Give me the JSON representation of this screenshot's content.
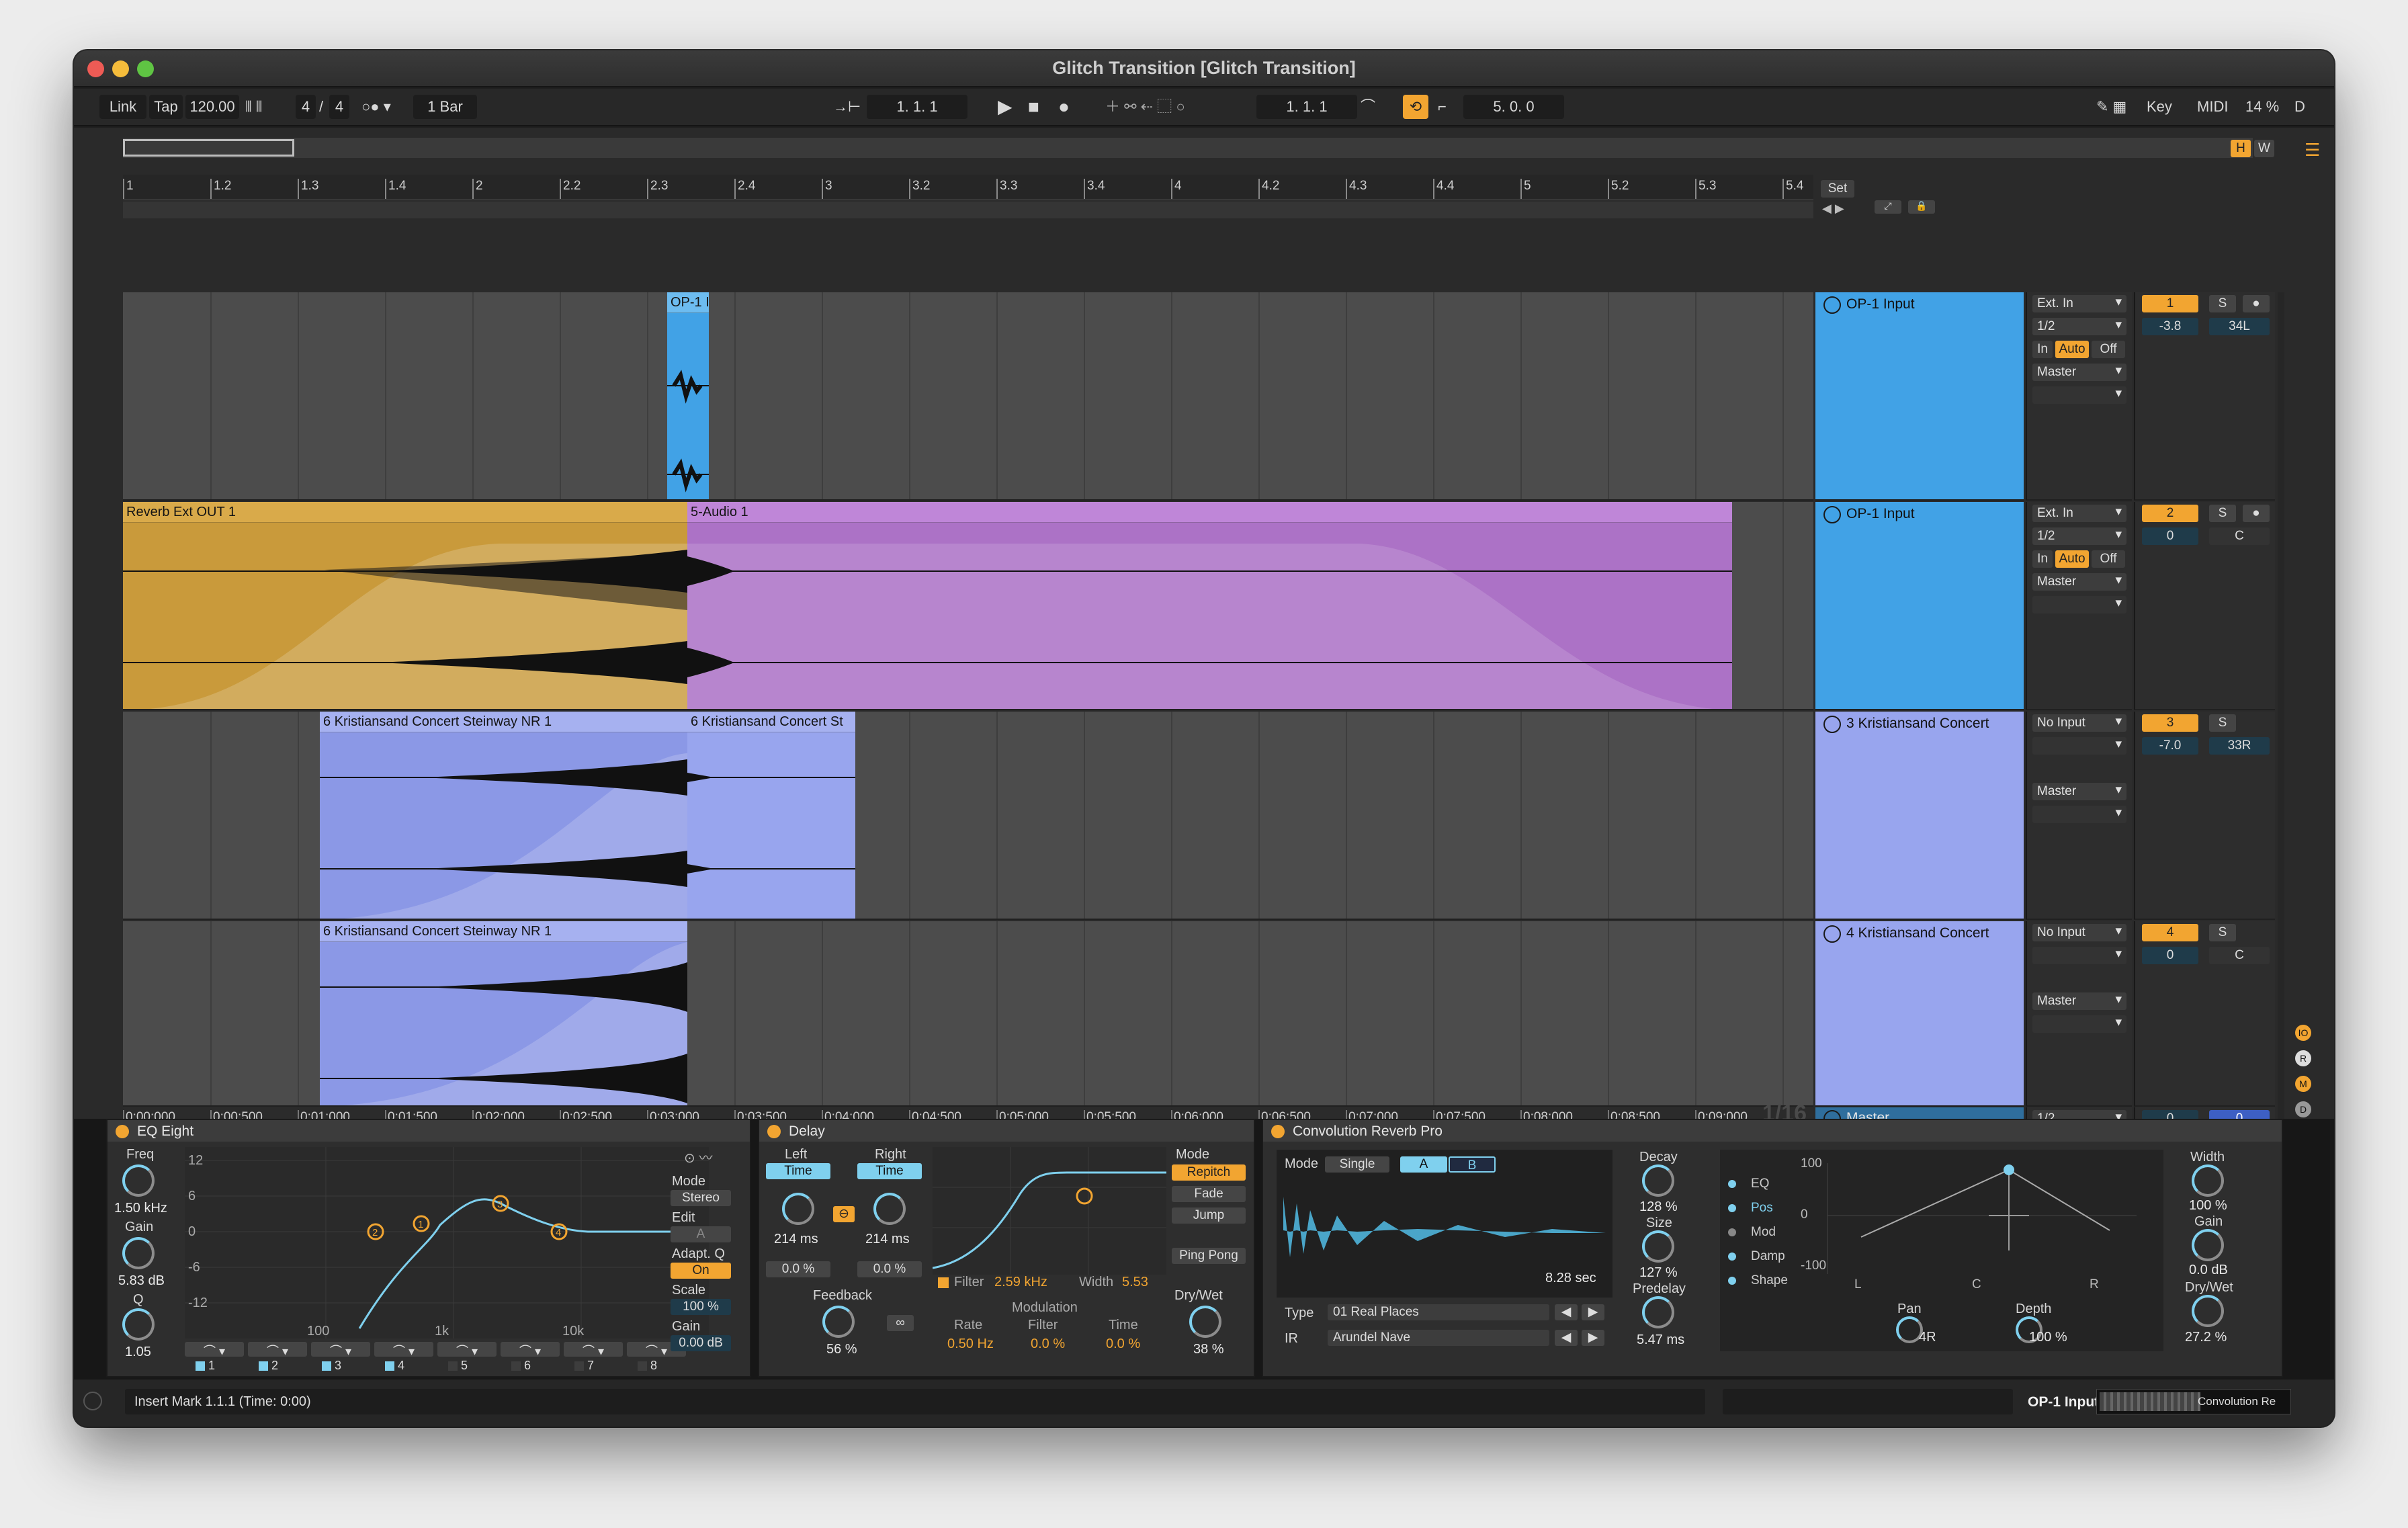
{
  "window": {
    "title": "Glitch Transition  [Glitch Transition]"
  },
  "transport": {
    "link": "Link",
    "tap": "Tap",
    "tempo": "120.00",
    "signature_num": "4",
    "signature_den": "4",
    "quantize": "1 Bar",
    "position": "1.   1.   1",
    "loop_start": "1.   1.   1",
    "loop_length": "5.   0.   0",
    "key": "Key",
    "midi": "MIDI",
    "cpu": "14 %",
    "d": "D"
  },
  "overview": {
    "h": "H",
    "w": "W"
  },
  "ruler": {
    "bars": [
      "1",
      "1.2",
      "1.3",
      "1.4",
      "2",
      "2.2",
      "2.3",
      "2.4",
      "3",
      "3.2",
      "3.3",
      "3.4",
      "4",
      "4.2",
      "4.3",
      "4.4",
      "5",
      "5.2",
      "5.3",
      "5.4"
    ],
    "times": [
      "0:00:000",
      "0:00:500",
      "0:01:000",
      "0:01:500",
      "0:02:000",
      "0:02:500",
      "0:03:000",
      "0:03:500",
      "0:04:000",
      "0:04:500",
      "0:05:000",
      "0:05:500",
      "0:06:000",
      "0:06:500",
      "0:07:000",
      "0:07:500",
      "0:08:000",
      "0:08:500",
      "0:09:000"
    ],
    "set": "Set",
    "grid": "1/16"
  },
  "tracks": [
    {
      "name": "OP-1 Input",
      "color": "#41a2e6",
      "input": "Ext. In",
      "channel": "1/2",
      "monitor": [
        "In",
        "Auto",
        "Off"
      ],
      "output": "Master",
      "number": "1",
      "s": "S",
      "volume": "-3.8",
      "pan": "34L",
      "clips": [
        {
          "name": "OP-1 I",
          "color": "#41a2e6"
        }
      ]
    },
    {
      "name": "OP-1 Input",
      "color": "#41a2e6",
      "input": "Ext. In",
      "channel": "1/2",
      "monitor": [
        "In",
        "Auto",
        "Off"
      ],
      "output": "Master",
      "number": "2",
      "s": "S",
      "volume": "0",
      "pan": "C",
      "clips": [
        {
          "name": "Reverb Ext OUT 1",
          "color": "#d5a440"
        },
        {
          "name": "5-Audio 1",
          "color": "#ba7fd2"
        }
      ]
    },
    {
      "name": "3 Kristiansand Concert",
      "color": "#98a5ee",
      "input": "No Input",
      "output": "Master",
      "number": "3",
      "s": "S",
      "volume": "-7.0",
      "pan": "33R",
      "clips": [
        {
          "name": "6 Kristiansand Concert Steinway NR 1",
          "color": "#98a5ee"
        },
        {
          "name": "6 Kristiansand Concert St",
          "color": "#98a5ee"
        }
      ]
    },
    {
      "name": "4 Kristiansand Concert",
      "color": "#98a5ee",
      "input": "No Input",
      "output": "Master",
      "number": "4",
      "s": "S",
      "volume": "0",
      "pan": "C",
      "clips": [
        {
          "name": "6 Kristiansand Concert Steinway NR 1",
          "color": "#98a5ee"
        }
      ]
    }
  ],
  "master": {
    "name": "Master",
    "channel": "1/2",
    "volume": "0",
    "pan": "0"
  },
  "side_letters": [
    "IO",
    "R",
    "M",
    "D"
  ],
  "eq": {
    "title": "EQ Eight",
    "freq_label": "Freq",
    "freq": "1.50 kHz",
    "gain_label": "Gain",
    "gain": "5.83 dB",
    "q_label": "Q",
    "q": "1.05",
    "db_ticks": [
      "12",
      "6",
      "0",
      "-6",
      "-12"
    ],
    "freq_ticks": [
      "100",
      "1k",
      "10k"
    ],
    "mode_label": "Mode",
    "mode": "Stereo",
    "edit_label": "Edit",
    "edit": "A",
    "adapt_label": "Adapt. Q",
    "adapt": "On",
    "scale_label": "Scale",
    "scale": "100 %",
    "out_gain_label": "Gain",
    "out_gain": "0.00 dB",
    "bands": [
      "1",
      "2",
      "3",
      "4",
      "5",
      "6",
      "7",
      "8"
    ],
    "nodes": [
      "1",
      "2",
      "3",
      "4"
    ]
  },
  "delay": {
    "title": "Delay",
    "left": "Left",
    "right": "Right",
    "time": "Time",
    "left_ms": "214 ms",
    "right_ms": "214 ms",
    "left_off": "0.0 %",
    "right_off": "0.0 %",
    "feedback_label": "Feedback",
    "feedback": "56 %",
    "filter_label": "Filter",
    "filter_freq": "2.59 kHz",
    "width_label": "Width",
    "width": "5.53",
    "modulation": "Modulation",
    "rate_label": "Rate",
    "rate": "0.50 Hz",
    "mfilter_label": "Filter",
    "mfilter": "0.0 %",
    "mtime_label": "Time",
    "mtime": "0.0 %",
    "mode_label": "Mode",
    "modes": [
      "Repitch",
      "Fade",
      "Jump"
    ],
    "ping_pong": "Ping Pong",
    "drywet_label": "Dry/Wet",
    "drywet": "38 %"
  },
  "reverb": {
    "title": "Convolution Reverb Pro",
    "mode_label": "Mode",
    "mode": "Single",
    "a": "A",
    "b": "B",
    "decay_time": "8.28 sec",
    "type_label": "Type",
    "type": "01 Real Places",
    "ir_label": "IR",
    "ir": "Arundel Nave",
    "decay_label": "Decay",
    "decay": "128 %",
    "size_label": "Size",
    "size": "127 %",
    "predelay_label": "Predelay",
    "predelay": "5.47 ms",
    "tabs": [
      "EQ",
      "Pos",
      "Mod",
      "Damp",
      "Shape"
    ],
    "y_ticks": [
      "100",
      "0",
      "-100"
    ],
    "x_ticks": [
      "L",
      "C",
      "R"
    ],
    "pan_label": "Pan",
    "pan": "4R",
    "depth_label": "Depth",
    "depth": "100 %",
    "width_label": "Width",
    "width": "100 %",
    "gain_label": "Gain",
    "gain": "0.0 dB",
    "drywet_label": "Dry/Wet",
    "drywet": "27.2 %"
  },
  "status": {
    "message": "Insert Mark 1.1.1 (Time: 0:00)",
    "track": "OP-1 Input",
    "device": "Convolution Re"
  }
}
